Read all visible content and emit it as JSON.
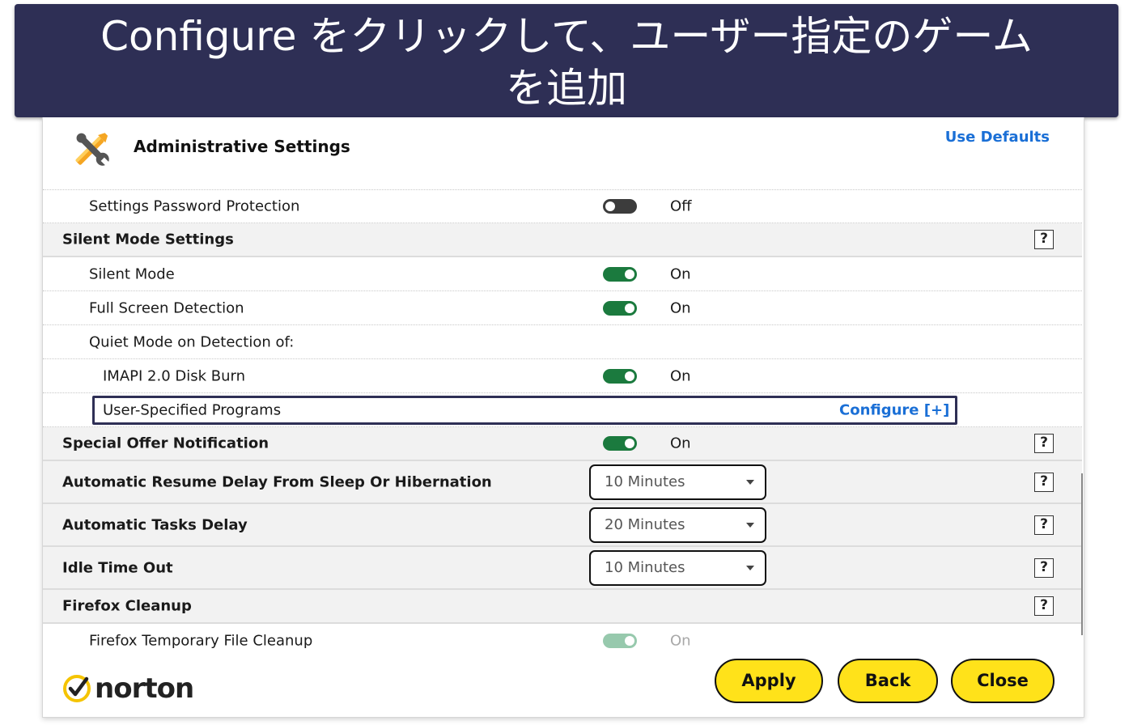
{
  "banner": {
    "line1": "Configure をクリックして、ユーザー指定のゲーム",
    "line2": "を追加"
  },
  "header": {
    "title": "Administrative Settings",
    "use_defaults": "Use Defaults",
    "icon": "tools-icon"
  },
  "rows": {
    "password_protection": {
      "label": "Settings Password Protection",
      "state": "Off"
    },
    "silent_mode_settings": {
      "label": "Silent Mode Settings",
      "help": "?"
    },
    "silent_mode": {
      "label": "Silent Mode",
      "state": "On"
    },
    "full_screen_detection": {
      "label": "Full Screen Detection",
      "state": "On"
    },
    "quiet_mode": {
      "label": "Quiet Mode on Detection of:"
    },
    "imapi": {
      "label": "IMAPI 2.0 Disk Burn",
      "state": "On"
    },
    "user_programs": {
      "label": "User-Specified Programs",
      "configure": "Configure [+]"
    },
    "special_offer": {
      "label": "Special Offer Notification",
      "state": "On",
      "help": "?"
    },
    "resume_delay": {
      "label": "Automatic Resume Delay From Sleep Or Hibernation",
      "value": "10 Minutes",
      "help": "?"
    },
    "tasks_delay": {
      "label": "Automatic Tasks Delay",
      "value": "20 Minutes",
      "help": "?"
    },
    "idle_timeout": {
      "label": "Idle Time Out",
      "value": "10 Minutes",
      "help": "?"
    },
    "firefox_cleanup": {
      "label": "Firefox Cleanup",
      "help": "?"
    },
    "firefox_temp": {
      "label": "Firefox Temporary File Cleanup",
      "state": "On"
    }
  },
  "footer": {
    "logo_text": "norton",
    "apply": "Apply",
    "back": "Back",
    "close": "Close"
  },
  "colors": {
    "banner_bg": "#2e2f55",
    "toggle_on": "#1b7a3e",
    "link": "#1a6fd6",
    "button_bg": "#ffe21a",
    "logo_yellow": "#f5c400"
  }
}
